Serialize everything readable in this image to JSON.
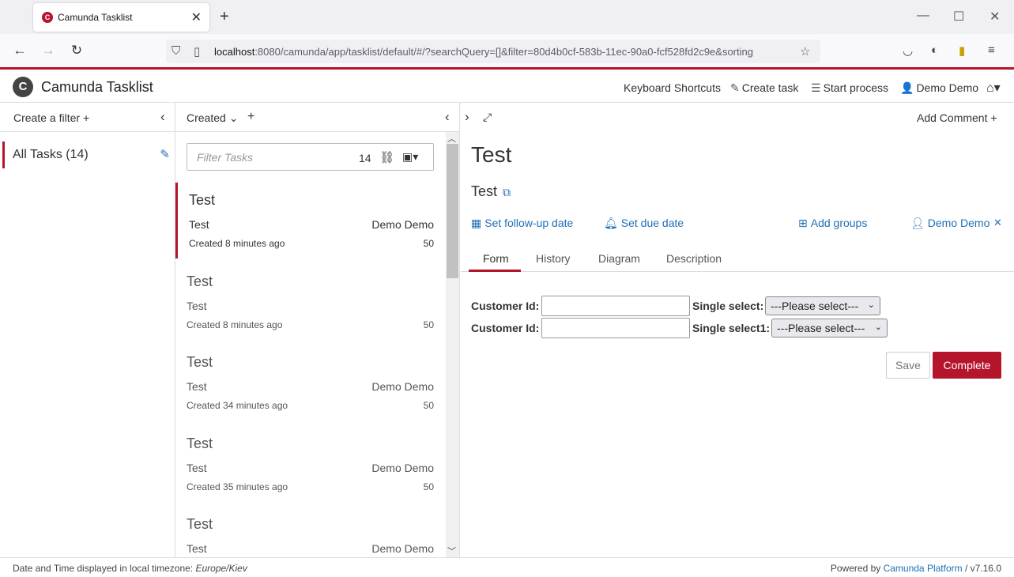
{
  "browser": {
    "tab_title": "Camunda Tasklist",
    "url_host": "localhost",
    "url_rest": ":8080/camunda/app/tasklist/default/#/?searchQuery=[]&filter=80d4b0cf-583b-11ec-90a0-fcf528fd2c9e&sorting"
  },
  "header": {
    "brand": "Camunda Tasklist",
    "keyboard_shortcuts": "Keyboard Shortcuts",
    "create_task": "Create task",
    "start_process": "Start process",
    "user": "Demo Demo"
  },
  "filters": {
    "create_filter": "Create a filter",
    "items": [
      {
        "label": "All Tasks (14)"
      }
    ]
  },
  "list": {
    "sort_label": "Created",
    "search_placeholder": "Filter Tasks",
    "count": "14",
    "tasks": [
      {
        "name": "Test",
        "process": "Test",
        "assignee": "Demo Demo",
        "created": "Created 8 minutes ago",
        "priority": "50"
      },
      {
        "name": "Test",
        "process": "Test",
        "assignee": "",
        "created": "Created 8 minutes ago",
        "priority": "50"
      },
      {
        "name": "Test",
        "process": "Test",
        "assignee": "Demo Demo",
        "created": "Created 34 minutes ago",
        "priority": "50"
      },
      {
        "name": "Test",
        "process": "Test",
        "assignee": "Demo Demo",
        "created": "Created 35 minutes ago",
        "priority": "50"
      },
      {
        "name": "Test",
        "process": "Test",
        "assignee": "Demo Demo",
        "created": "",
        "priority": ""
      }
    ]
  },
  "detail": {
    "add_comment": "Add Comment",
    "title": "Test",
    "subtitle": "Test",
    "follow_up": "Set follow-up date",
    "due_date": "Set due date",
    "add_groups": "Add groups",
    "assignee": "Demo Demo",
    "tabs": [
      "Form",
      "History",
      "Diagram",
      "Description"
    ],
    "form": {
      "customer_id_1": "Customer Id:",
      "single_select": "Single select:",
      "select_1_value": "---Please select---",
      "customer_id_2": "Customer Id:",
      "single_select1": "Single select1:",
      "select_2_value": "---Please select---"
    },
    "save": "Save",
    "complete": "Complete"
  },
  "footer": {
    "timezone_prefix": "Date and Time displayed in local timezone: ",
    "timezone": "Europe/Kiev",
    "powered_by": "Powered by ",
    "platform": "Camunda Platform",
    "version": " / v7.16.0"
  }
}
